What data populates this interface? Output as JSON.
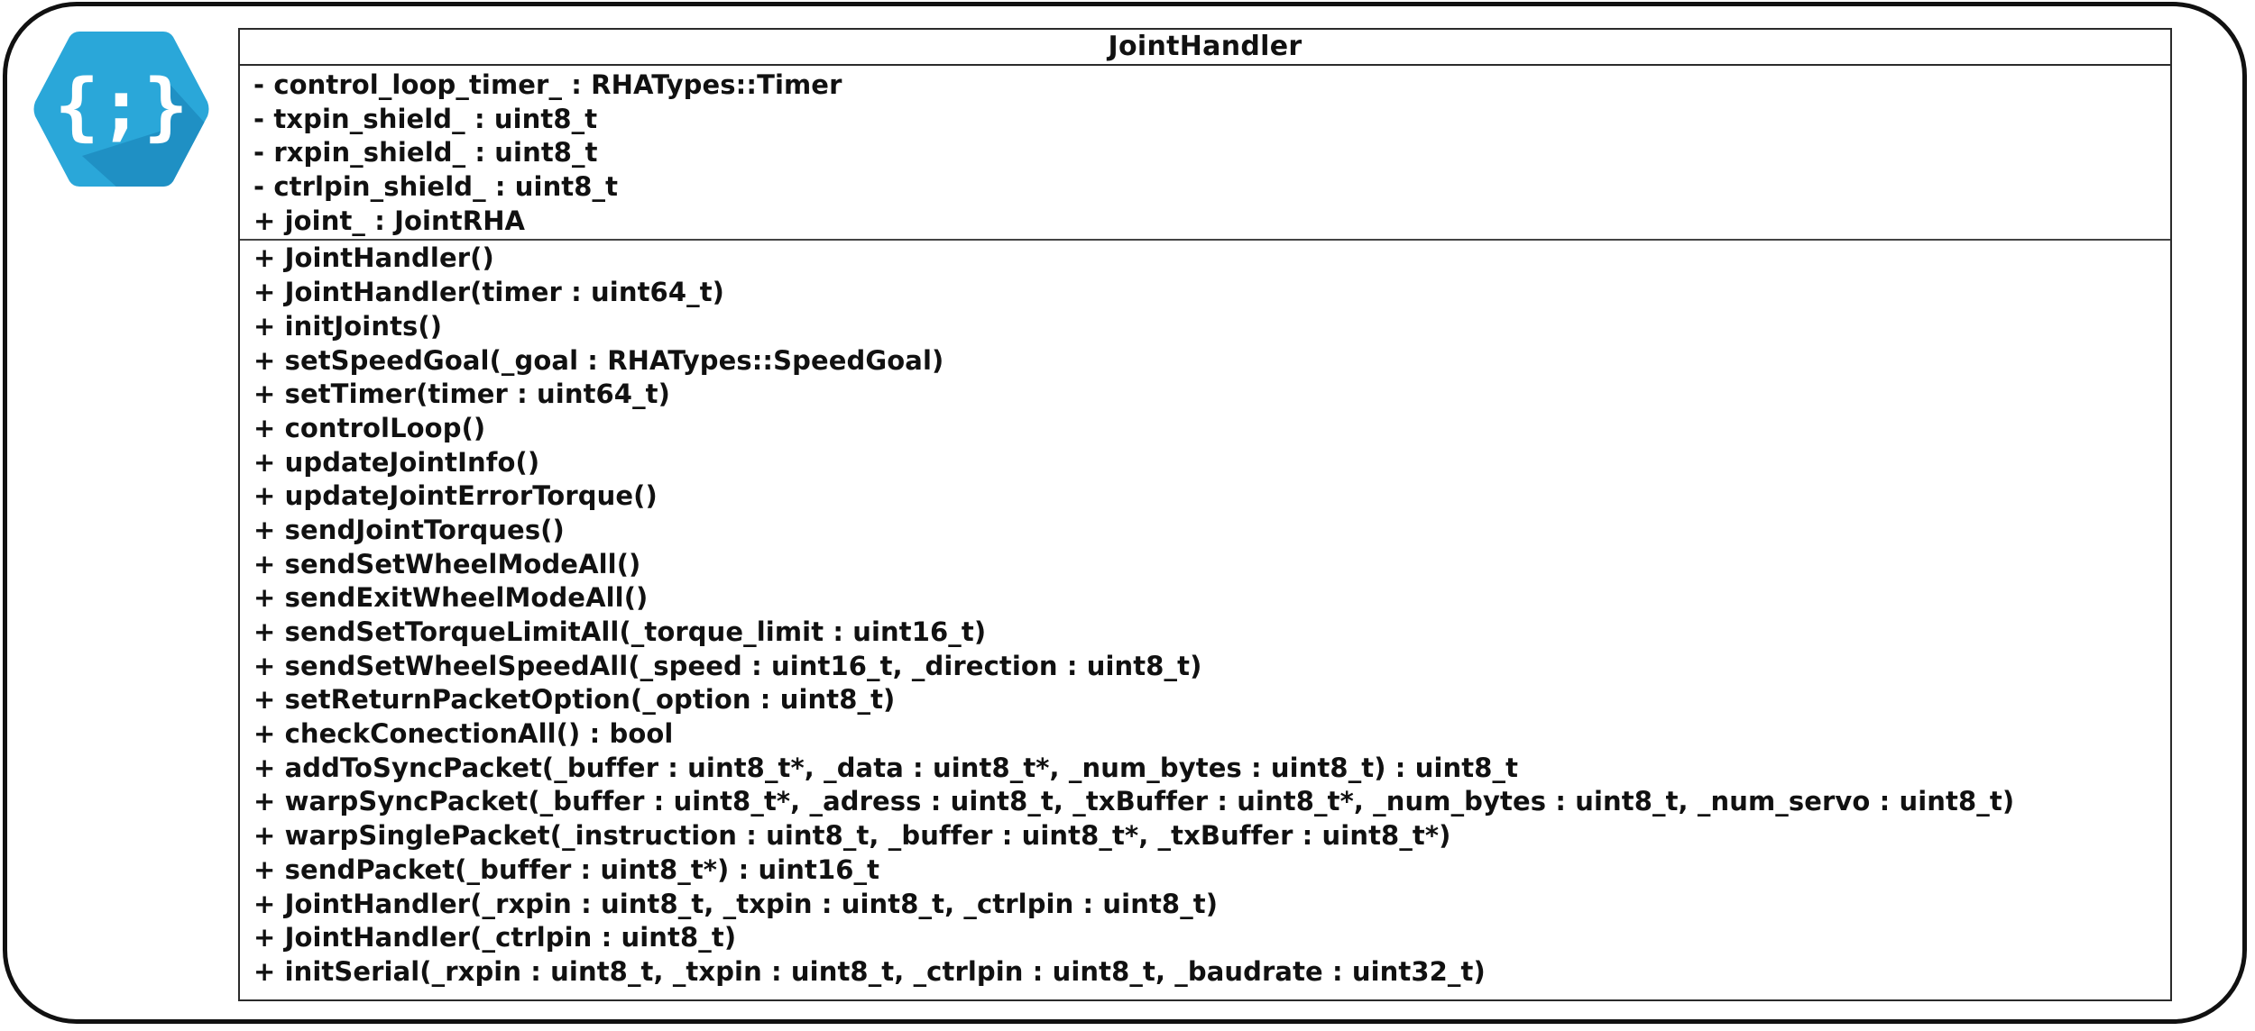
{
  "logo": {
    "icon": "curly-braces-semicolon-icon",
    "glyph": "{;}",
    "color_light": "#2aa7d9",
    "color_dark": "#1d8cc0"
  },
  "uml_class": {
    "name": "JointHandler",
    "attributes": [
      "- control_loop_timer_ : RHATypes::Timer",
      "- txpin_shield_ : uint8_t",
      "- rxpin_shield_ : uint8_t",
      "- ctrlpin_shield_ : uint8_t",
      "+ joint_ : JointRHA"
    ],
    "methods": [
      "+ JointHandler()",
      "+ JointHandler(timer : uint64_t)",
      "+ initJoints()",
      "+ setSpeedGoal(_goal : RHATypes::SpeedGoal)",
      "+ setTimer(timer : uint64_t)",
      "+ controlLoop()",
      "+ updateJointInfo()",
      "+ updateJointErrorTorque()",
      "+ sendJointTorques()",
      "+ sendSetWheelModeAll()",
      "+ sendExitWheelModeAll()",
      "+ sendSetTorqueLimitAll(_torque_limit : uint16_t)",
      "+ sendSetWheelSpeedAll(_speed : uint16_t, _direction : uint8_t)",
      "+ setReturnPacketOption(_option : uint8_t)",
      "+ checkConectionAll() : bool",
      "+ addToSyncPacket(_buffer : uint8_t*, _data : uint8_t*, _num_bytes : uint8_t) : uint8_t",
      "+ warpSyncPacket(_buffer : uint8_t*, _adress : uint8_t, _txBuffer : uint8_t*, _num_bytes : uint8_t, _num_servo : uint8_t)",
      "+ warpSinglePacket(_instruction : uint8_t, _buffer : uint8_t*, _txBuffer : uint8_t*)",
      "+ sendPacket(_buffer : uint8_t*) : uint16_t",
      "+ JointHandler(_rxpin : uint8_t, _txpin : uint8_t, _ctrlpin : uint8_t)",
      "+ JointHandler(_ctrlpin : uint8_t)",
      "+ initSerial(_rxpin : uint8_t, _txpin : uint8_t, _ctrlpin : uint8_t, _baudrate : uint32_t)"
    ]
  }
}
